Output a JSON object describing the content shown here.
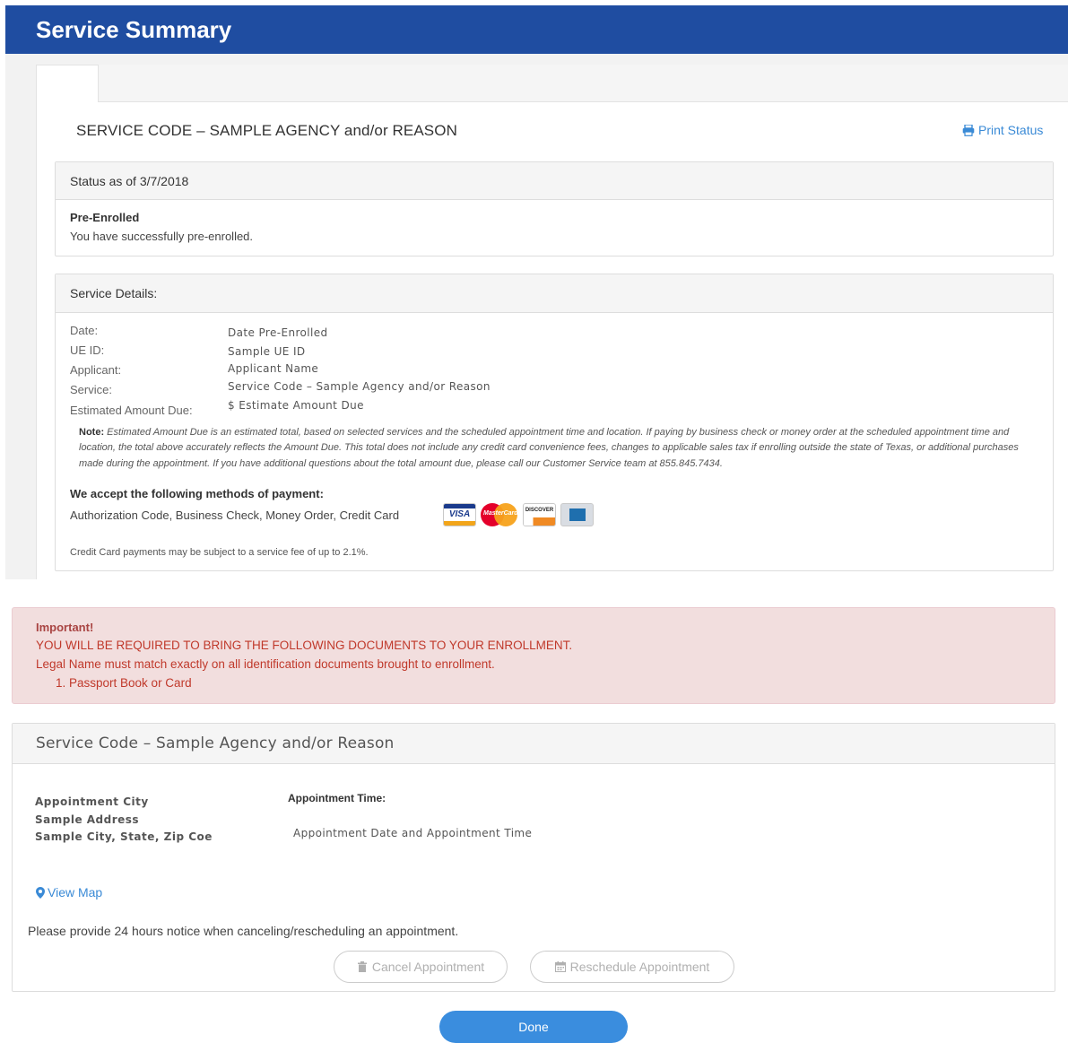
{
  "header": {
    "title": "Service Summary"
  },
  "service": {
    "title": "SERVICE CODE – SAMPLE AGENCY and/or REASON",
    "print_label": "Print Status"
  },
  "status": {
    "heading": "Status as of 3/7/2018",
    "state": "Pre-Enrolled",
    "message": "You have successfully pre-enrolled."
  },
  "details": {
    "heading": "Service Details:",
    "rows": [
      {
        "label": "Date:",
        "value": "Date Pre-Enrolled"
      },
      {
        "label": "UE ID:",
        "value": "Sample UE ID"
      },
      {
        "label": "Applicant:",
        "value": "Applicant Name"
      },
      {
        "label": "Service:",
        "value": "Service Code – Sample Agency and/or Reason"
      },
      {
        "label": "Estimated Amount Due:",
        "value": "$ Estimate Amount Due"
      }
    ],
    "note_label": "Note:",
    "note_text": "Estimated Amount Due is an estimated total, based on selected services and the scheduled appointment time and location. If paying by business check or money order at the scheduled appointment time and location, the total above accurately reflects the Amount Due. This total does not include any credit card convenience fees, changes to applicable sales tax if enrolling outside the state of Texas, or additional purchases made during the appointment. If you have additional questions about the total amount due, please call our Customer Service team at 855.845.7434.",
    "payment_heading": "We accept the following methods of payment:",
    "payment_methods": "Authorization Code, Business Check, Money Order, Credit Card",
    "cards": [
      {
        "name": "visa-card-icon",
        "text": "VISA"
      },
      {
        "name": "mastercard-card-icon",
        "text": "MasterCard"
      },
      {
        "name": "discover-card-icon",
        "text": "DISCOVER"
      },
      {
        "name": "amex-card-icon",
        "text": ""
      }
    ],
    "cc_fee": "Credit Card payments may be subject to a service fee of up to 2.1%."
  },
  "alert": {
    "title": "Important!",
    "line1": "YOU WILL BE REQUIRED TO BRING THE FOLLOWING DOCUMENTS TO YOUR ENROLLMENT.",
    "line2": "Legal Name must match exactly on all identification documents brought to enrollment.",
    "item1": "1.  Passport Book or Card"
  },
  "appointment": {
    "heading": "Service Code – Sample Agency and/or Reason",
    "city": "Appointment City",
    "address": "Sample Address",
    "city_state_zip": "Sample City, State, Zip Coe",
    "time_label": "Appointment Time:",
    "time_value": "Appointment Date and Appointment Time",
    "view_map": "View Map",
    "notice": "Please provide 24 hours notice when canceling/rescheduling an appointment.",
    "cancel_label": "Cancel Appointment",
    "reschedule_label": "Reschedule Appointment"
  },
  "done_label": "Done",
  "colors": {
    "header_bg": "#1f4da1",
    "link": "#3a8ad6",
    "alert_bg": "#f2dede",
    "alert_text": "#c0392b",
    "done_bg": "#3a8dde"
  }
}
